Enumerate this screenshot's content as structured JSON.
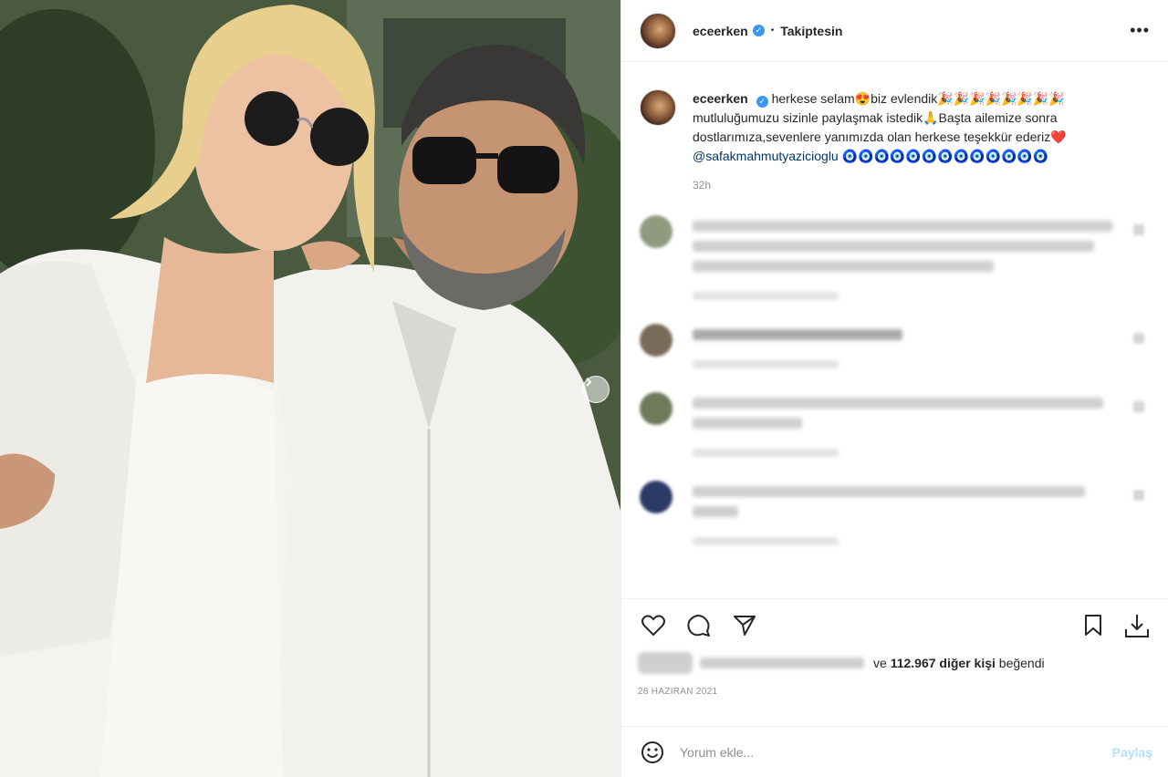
{
  "post": {
    "username": "eceerken",
    "follow_state": "Takiptesin",
    "caption_parts": {
      "p1": "herkese selam",
      "e1": "😍",
      "p2": "biz evlendik",
      "e2": "🎉🎉🎉🎉🎉🎉🎉🎉",
      "p3": " mutluluğumuzu sizinle paylaşmak istedik",
      "e3": "🙏",
      "p4": "Başta ailemize sonra dostlarımıza,sevenlere yanımızda olan herkese teşekkür ederiz",
      "e4": "❤️",
      "mention": "@safakmahmutyazicioglu",
      "e5": "🧿🧿🧿🧿🧿🧿🧿🧿🧿🧿🧿🧿🧿"
    },
    "caption_time": "32h",
    "likes": {
      "prefix": "ve",
      "count": "112.967 diğer kişi",
      "suffix": "beğendi"
    },
    "date": "28 Haziran 2021"
  },
  "composer": {
    "placeholder": "Yorum ekle...",
    "post_label": "Paylaş"
  },
  "icons": {
    "more": "more-options-icon",
    "like": "heart-icon",
    "comment": "comment-icon",
    "share": "send-icon",
    "save": "bookmark-icon",
    "download": "download-icon",
    "emoji": "emoji-icon",
    "carousel": "chevron-right-icon"
  },
  "colors": {
    "accent": "#3897f0",
    "mention": "#00376b",
    "secondary_text": "#8e8e8e",
    "post_button": "#b2dffc"
  }
}
